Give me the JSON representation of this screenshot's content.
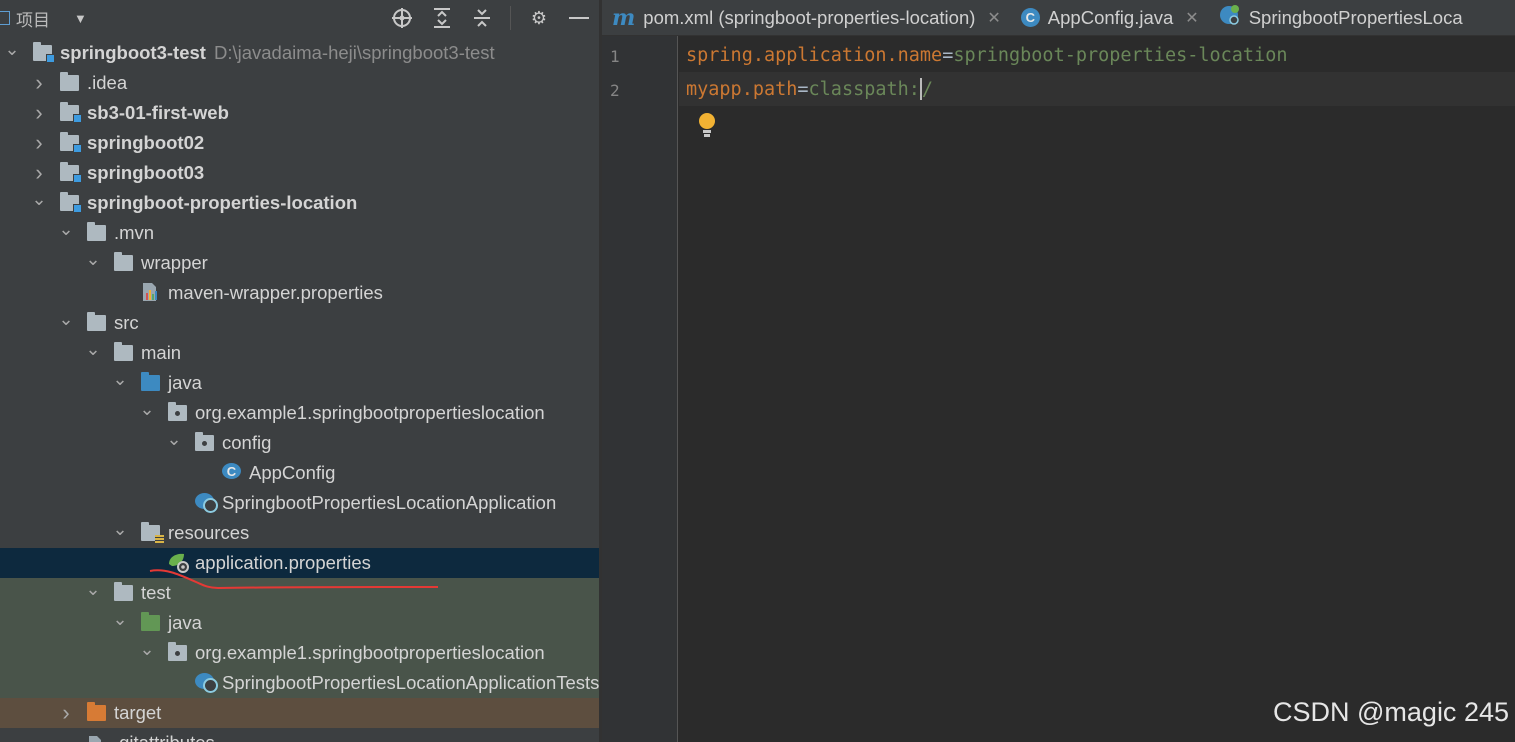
{
  "panel": {
    "title": "项目",
    "tools": [
      "locate-icon",
      "expand-all-icon",
      "collapse-all-icon",
      "gear-icon",
      "minimize-icon"
    ]
  },
  "tree": [
    {
      "depth": 0,
      "arrow": "down",
      "icon": "module-root",
      "label": "springboot3-test",
      "path": "D:\\javadaima-heji\\springboot3-test",
      "bold": true
    },
    {
      "depth": 1,
      "arrow": "right",
      "icon": "folder",
      "label": ".idea"
    },
    {
      "depth": 1,
      "arrow": "right",
      "icon": "module",
      "label": "sb3-01-first-web",
      "bold": true
    },
    {
      "depth": 1,
      "arrow": "right",
      "icon": "module",
      "label": "springboot02",
      "bold": true
    },
    {
      "depth": 1,
      "arrow": "right",
      "icon": "module",
      "label": "springboot03",
      "bold": true
    },
    {
      "depth": 1,
      "arrow": "down",
      "icon": "module",
      "label": "springboot-properties-location",
      "bold": true
    },
    {
      "depth": 2,
      "arrow": "down",
      "icon": "folder",
      "label": ".mvn"
    },
    {
      "depth": 3,
      "arrow": "down",
      "icon": "folder",
      "label": "wrapper"
    },
    {
      "depth": 4,
      "arrow": "",
      "icon": "properties",
      "label": "maven-wrapper.properties"
    },
    {
      "depth": 2,
      "arrow": "down",
      "icon": "folder",
      "label": "src"
    },
    {
      "depth": 3,
      "arrow": "down",
      "icon": "folder",
      "label": "main"
    },
    {
      "depth": 4,
      "arrow": "down",
      "icon": "folder-blue",
      "label": "java"
    },
    {
      "depth": 5,
      "arrow": "down",
      "icon": "package",
      "label": "org.example1.springbootpropertieslocation"
    },
    {
      "depth": 6,
      "arrow": "down",
      "icon": "package",
      "label": "config"
    },
    {
      "depth": 7,
      "arrow": "",
      "icon": "class",
      "label": "AppConfig"
    },
    {
      "depth": 6,
      "arrow": "",
      "icon": "spring-class",
      "label": "SpringbootPropertiesLocationApplication"
    },
    {
      "depth": 4,
      "arrow": "down",
      "icon": "resources",
      "label": "resources"
    },
    {
      "depth": 5,
      "arrow": "",
      "icon": "spring-properties",
      "label": "application.properties",
      "selected": true
    },
    {
      "depth": 3,
      "arrow": "down",
      "icon": "folder",
      "label": "test",
      "bg": "test"
    },
    {
      "depth": 4,
      "arrow": "down",
      "icon": "folder-green",
      "label": "java",
      "bg": "test"
    },
    {
      "depth": 5,
      "arrow": "down",
      "icon": "package",
      "label": "org.example1.springbootpropertieslocation",
      "bg": "test"
    },
    {
      "depth": 6,
      "arrow": "",
      "icon": "spring-class",
      "label": "SpringbootPropertiesLocationApplicationTests",
      "bg": "test"
    },
    {
      "depth": 2,
      "arrow": "right",
      "icon": "folder-orange",
      "label": "target",
      "bg": "target"
    },
    {
      "depth": 2,
      "arrow": "",
      "icon": "file",
      "label": ".gitattributes"
    }
  ],
  "tabs": [
    {
      "icon": "maven-icon",
      "label": "pom.xml (springboot-properties-location)",
      "closable": true
    },
    {
      "icon": "class-icon",
      "label": "AppConfig.java",
      "closable": true
    },
    {
      "icon": "spring-class-icon",
      "label": "SpringbootPropertiesLoca",
      "closable": false
    }
  ],
  "editor": {
    "lines": [
      {
        "number": "1",
        "key": "spring.application.name",
        "eq": "=",
        "value": "springboot-properties-location"
      },
      {
        "number": "2",
        "key": "myapp.path",
        "eq": "=",
        "value": "classpath:",
        "after_caret": "/"
      }
    ]
  },
  "watermark": "CSDN @magic 245",
  "colors": {
    "panel_bg": "#3c3f41",
    "editor_bg": "#2b2b2b",
    "selection": "#0d293e",
    "key": "#cc7832",
    "value": "#6a8759",
    "annotation": "#e53935"
  }
}
